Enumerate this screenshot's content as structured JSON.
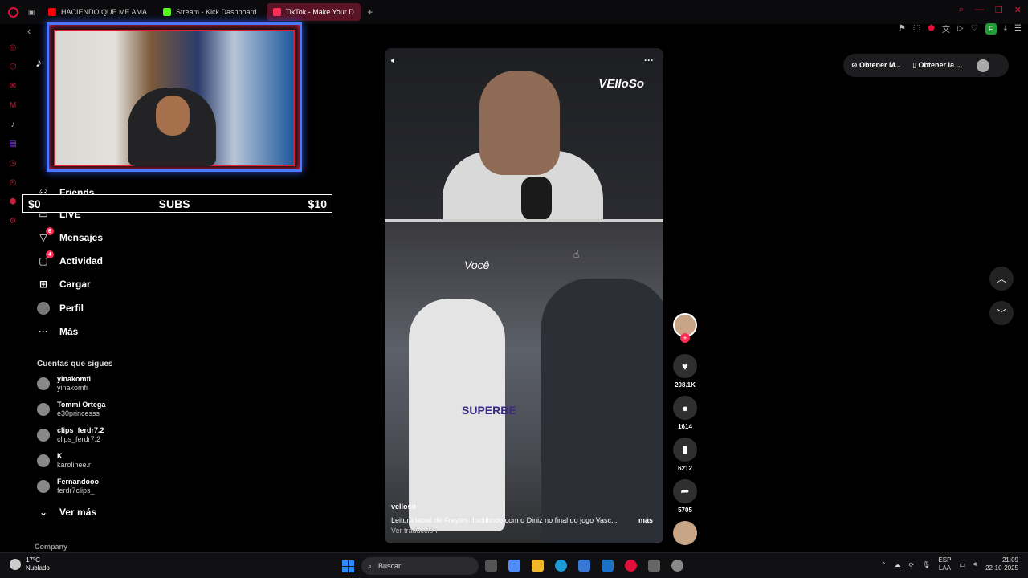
{
  "browser": {
    "tabs": [
      {
        "label": "HACIENDO QUE ME AMA",
        "color": "#ff0000",
        "active": false
      },
      {
        "label": "Stream - Kick Dashboard",
        "color": "#53fc18",
        "active": false
      },
      {
        "label": "TikTok - Make Your D",
        "color": "#fe2c55",
        "active": true
      }
    ],
    "new_tab": "+",
    "back": "‹",
    "ext_badge": "F",
    "window_controls": [
      "⌕",
      "—",
      "❐",
      "✕"
    ]
  },
  "overlay": {
    "subs_left": "$0",
    "subs_label": "SUBS",
    "subs_right": "$10"
  },
  "tiktok": {
    "logo": "♪",
    "nav": [
      {
        "label": "Friends",
        "icon": "friends-icon"
      },
      {
        "label": "LIVE",
        "icon": "live-icon"
      },
      {
        "label": "Mensajes",
        "icon": "messages-icon",
        "badge": "6"
      },
      {
        "label": "Actividad",
        "icon": "activity-icon",
        "badge": "4"
      },
      {
        "label": "Cargar",
        "icon": "upload-icon"
      },
      {
        "label": "Perfil",
        "icon": "profile-icon"
      },
      {
        "label": "Más",
        "icon": "more-icon"
      }
    ],
    "following_header": "Cuentas que sigues",
    "following": [
      {
        "name": "yinakomfi",
        "user": "yinakomfi"
      },
      {
        "name": "Tommi Ortega",
        "user": "e30princesss"
      },
      {
        "name": "clips_ferdr7.2",
        "user": "clips_ferdr7.2"
      },
      {
        "name": "K",
        "user": "karolinee.r"
      },
      {
        "name": "Fernandooo",
        "user": "ferdr7clips_"
      }
    ],
    "see_more": "Ver más",
    "company": "Company",
    "video": {
      "watermark": "VElloSo",
      "caption": "Você",
      "user": "velloso",
      "description": "Leitura labial de Freytes discutindo com o Diniz no final do jogo Vasc...",
      "more": "más",
      "translate": "Ver traducción",
      "jersey": "SUPERBE"
    },
    "stats": {
      "likes": "208.1K",
      "comments": "1614",
      "saves": "6212",
      "shares": "5705"
    },
    "top_pill": {
      "item1": "Obtener M...",
      "item2": "Obtener la ..."
    }
  },
  "taskbar": {
    "temp": "17°C",
    "weather": "Nublado",
    "search_placeholder": "Buscar",
    "lang1": "ESP",
    "lang2": "LAA",
    "time": "21:09",
    "date": "22-10-2025"
  }
}
